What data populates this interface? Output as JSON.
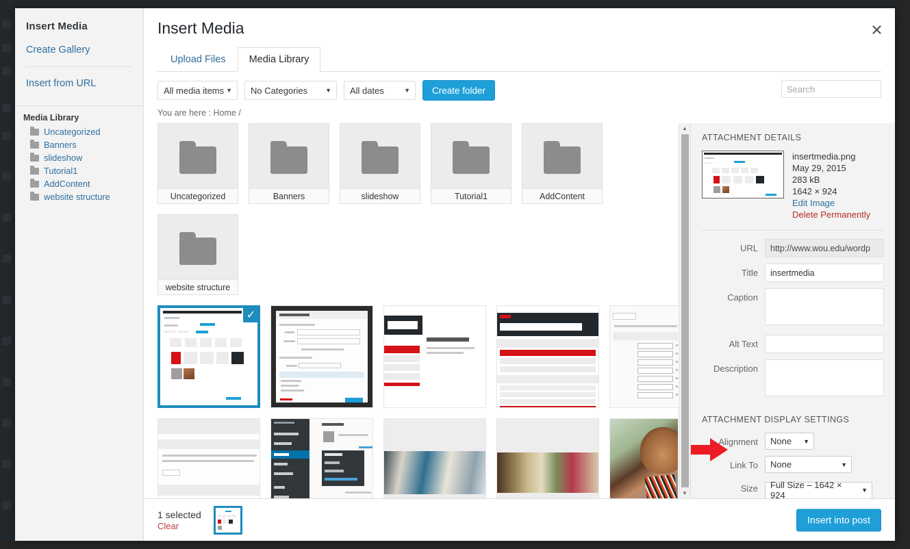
{
  "sidebar": {
    "title": "Insert Media",
    "create_gallery": "Create Gallery",
    "insert_from_url": "Insert from URL",
    "library_title": "Media Library",
    "folders": [
      {
        "label": "Uncategorized"
      },
      {
        "label": "Banners"
      },
      {
        "label": "slideshow"
      },
      {
        "label": "Tutorial1"
      },
      {
        "label": "AddContent"
      },
      {
        "label": "website structure"
      }
    ]
  },
  "modal": {
    "title": "Insert Media",
    "close_icon": "close-icon",
    "tabs": [
      {
        "label": "Upload Files",
        "active": false
      },
      {
        "label": "Media Library",
        "active": true
      }
    ]
  },
  "toolbar": {
    "media_filter": "All media items",
    "category_filter": "No Categories",
    "date_filter": "All dates",
    "create_folder_label": "Create folder",
    "search_placeholder": "Search",
    "search_value": ""
  },
  "breadcrumb": "You are here : Home /",
  "grid": {
    "folders": [
      {
        "label": "Uncategorized"
      },
      {
        "label": "Banners"
      },
      {
        "label": "slideshow"
      },
      {
        "label": "Tutorial1"
      },
      {
        "label": "AddContent"
      },
      {
        "label": "website structure"
      }
    ],
    "items": [
      {
        "name": "insertmedia-screenshot",
        "selected": true,
        "kind": "screenshot-media-library"
      },
      {
        "name": "insert-edit-link-dialog",
        "selected": false,
        "kind": "screenshot-dialog"
      },
      {
        "name": "interior-page-template",
        "selected": false,
        "kind": "screenshot-interior"
      },
      {
        "name": "majors-and-minors-page",
        "selected": false,
        "kind": "screenshot-majors"
      },
      {
        "name": "menu-locations-screen",
        "selected": false,
        "kind": "screenshot-locations"
      },
      {
        "name": "reading-settings-screen",
        "selected": false,
        "kind": "screenshot-settings"
      },
      {
        "name": "document-text-screenshot",
        "selected": false,
        "kind": "screenshot-doc"
      },
      {
        "name": "users-admin-menu",
        "selected": false,
        "kind": "screenshot-usersmenu"
      },
      {
        "name": "students-photo",
        "selected": false,
        "kind": "photo-students"
      },
      {
        "name": "campus-photo",
        "selected": false,
        "kind": "photo-campus"
      },
      {
        "name": "portrait-photo",
        "selected": false,
        "kind": "photo-portrait"
      }
    ]
  },
  "details": {
    "heading": "ATTACHMENT DETAILS",
    "filename": "insertmedia.png",
    "date": "May 29, 2015",
    "filesize": "283 kB",
    "dimensions": "1642 × 924",
    "edit_image": "Edit Image",
    "delete_permanently": "Delete Permanently",
    "fields": {
      "url_label": "URL",
      "url_value": "http://www.wou.edu/wordp",
      "title_label": "Title",
      "title_value": "insertmedia",
      "caption_label": "Caption",
      "caption_value": "",
      "alt_label": "Alt Text",
      "alt_value": "",
      "description_label": "Description",
      "description_value": ""
    },
    "display_heading": "ATTACHMENT DISPLAY SETTINGS",
    "alignment_label": "Alignment",
    "alignment_value": "None",
    "link_to_label": "Link To",
    "link_to_value": "None",
    "size_label": "Size",
    "size_value": "Full Size – 1642 × 924"
  },
  "footer": {
    "selected_count": "1 selected",
    "clear_label": "Clear",
    "insert_label": "Insert into post"
  },
  "annotation": {
    "arrow_color": "#ec1c24",
    "points_to": "Alignment"
  },
  "colors": {
    "accent": "#1e9fd8",
    "selection": "#1e8cbe",
    "link": "#2f6f9f",
    "danger": "#b52b27"
  }
}
